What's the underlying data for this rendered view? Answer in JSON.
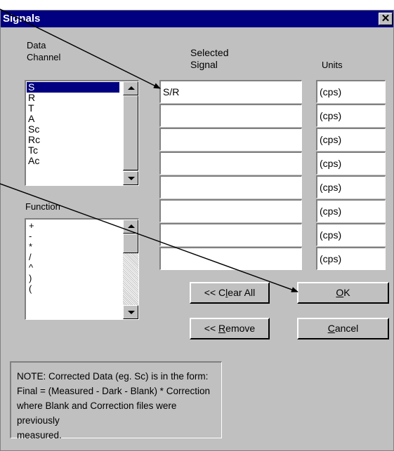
{
  "dialog": {
    "title": "Signals",
    "close_glyph": "✕"
  },
  "labels": {
    "data_channel": "Data\nChannel",
    "selected_signal": "Selected\nSignal",
    "units": "Units",
    "function": "Function"
  },
  "data_channel_list": [
    "S",
    "R",
    "T",
    "A",
    "Sc",
    "Rc",
    "Tc",
    "Ac"
  ],
  "data_channel_selected": "S",
  "function_list": [
    "+",
    "-",
    "*",
    "/",
    "^",
    ")",
    "(",
    ""
  ],
  "selected_signals": [
    "S/R",
    "",
    "",
    "",
    "",
    "",
    "",
    ""
  ],
  "units": [
    "(cps)",
    "(cps)",
    "(cps)",
    "(cps)",
    "(cps)",
    "(cps)",
    "(cps)",
    "(cps)"
  ],
  "buttons": {
    "clear_all_prefix": "<< C",
    "clear_all_mnemonic": "l",
    "clear_all_suffix": "ear All",
    "remove_prefix": "<< ",
    "remove_mnemonic": "R",
    "remove_suffix": "emove",
    "ok_mnemonic": "O",
    "ok_suffix": "K",
    "cancel_mnemonic": "C",
    "cancel_suffix": "ancel"
  },
  "note": {
    "line1": "NOTE: Corrected Data (eg. Sc) is in the form:",
    "line2": "Final = (Measured - Dark - Blank) * Correction",
    "line3": "where Blank and Correction files were previously",
    "line4": "measured."
  }
}
